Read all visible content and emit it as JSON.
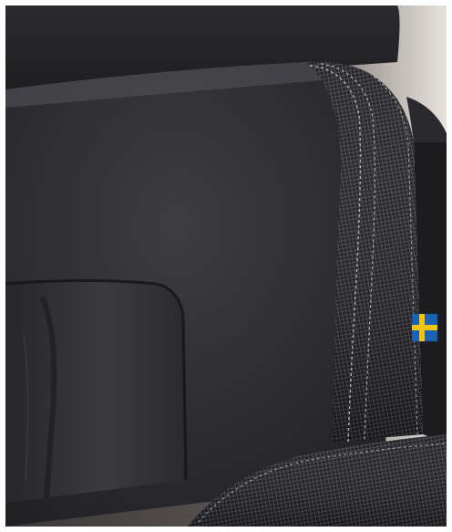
{
  "image": {
    "subject": "seat-closeup",
    "colors": {
      "frame": "#ffffff",
      "background_wall": "#e7e2dc",
      "leather_dark": "#1f1f21",
      "leather_mid": "#3a3a3d",
      "leather_highlight": "#5a5a5e",
      "textile_dark": "#1b1b1d",
      "textile_light": "#6b6b70",
      "stitching": "#bdbdc2",
      "flag_blue": "#1d63b4",
      "flag_yellow": "#f1c40f"
    },
    "icons": {
      "flag_tag": "swedish-flag-icon"
    }
  }
}
